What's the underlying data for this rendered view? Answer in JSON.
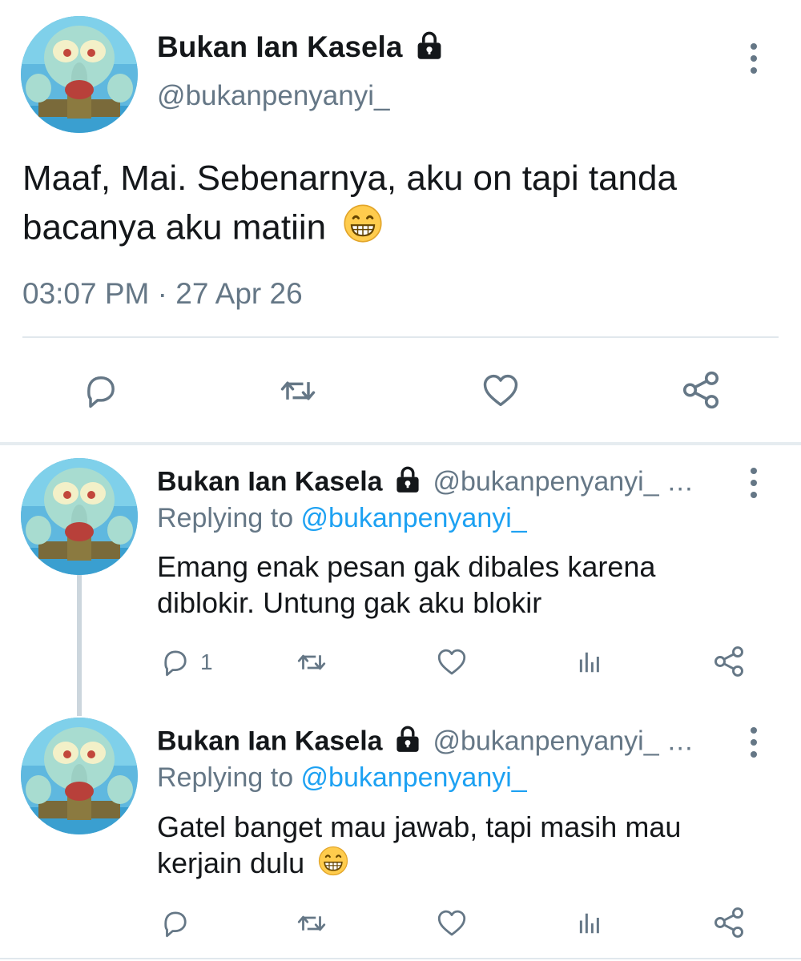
{
  "main_tweet": {
    "name": "Bukan Ian Kasela",
    "handle": "@bukanpenyanyi_",
    "text": "Maaf, Mai. Sebenarnya, aku on tapi tanda bacanya aku matiin",
    "emoji": "grin-emoji",
    "timestamp": "03:07 PM · 27 Apr 26",
    "actions": [
      "reply-icon",
      "retweet-icon",
      "like-icon",
      "share-icon"
    ]
  },
  "replies": [
    {
      "name": "Bukan Ian Kasela",
      "handle": "@bukanpenyanyi_ …",
      "replying_prefix": "Replying to ",
      "replying_to": "@bukanpenyanyi_",
      "text": "Emang enak pesan gak dibales karena diblokir. Untung gak aku blokir",
      "reply_count": "1",
      "actions": [
        "reply-icon",
        "retweet-icon",
        "like-icon",
        "analytics-icon",
        "share-icon"
      ]
    },
    {
      "name": "Bukan Ian Kasela",
      "handle": "@bukanpenyanyi_ …",
      "replying_prefix": "Replying to ",
      "replying_to": "@bukanpenyanyi_",
      "text": "Gatel banget mau jawab, tapi masih mau kerjain dulu",
      "emoji": "grin-emoji",
      "reply_count": "",
      "actions": [
        "reply-icon",
        "retweet-icon",
        "like-icon",
        "analytics-icon",
        "share-icon"
      ]
    }
  ],
  "colors": {
    "text": "#14171a",
    "muted": "#657786",
    "link": "#1da1f2",
    "divider": "#e1e8ed"
  }
}
